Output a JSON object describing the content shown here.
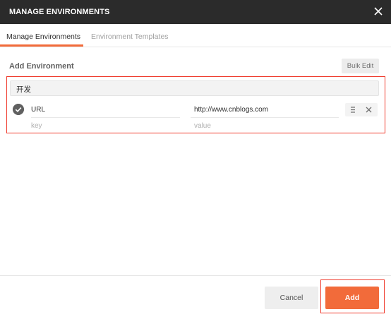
{
  "dialog": {
    "title": "MANAGE ENVIRONMENTS",
    "close_icon": "close-icon"
  },
  "tabs": [
    {
      "label": "Manage Environments",
      "active": true
    },
    {
      "label": "Environment Templates",
      "active": false
    }
  ],
  "section": {
    "title": "Add Environment",
    "bulk_edit_label": "Bulk Edit"
  },
  "environment": {
    "name": "开发",
    "variables": [
      {
        "key": "URL",
        "value": "http://www.cnblogs.com",
        "enabled": true
      }
    ],
    "new_row": {
      "key_placeholder": "key",
      "value_placeholder": "value"
    }
  },
  "footer": {
    "cancel_label": "Cancel",
    "add_label": "Add"
  },
  "colors": {
    "accent": "#f26b3a",
    "titlebar": "#2b2b2b",
    "highlight": "#ef3b2d"
  }
}
